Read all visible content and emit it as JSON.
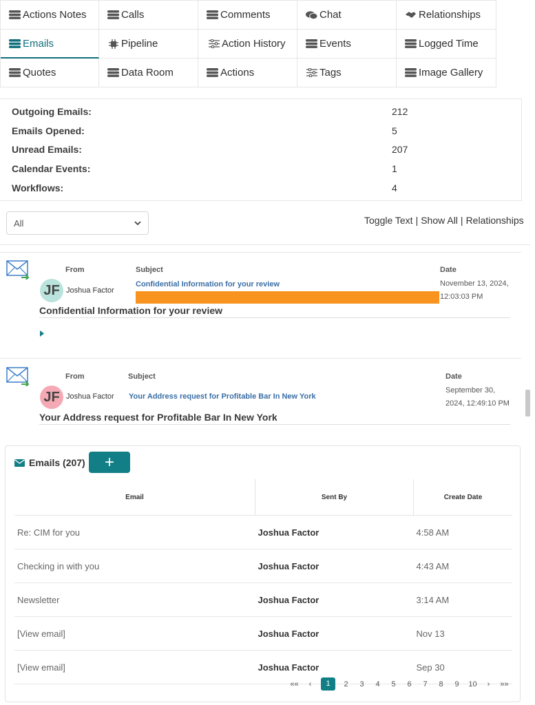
{
  "tabs": [
    {
      "label": "Actions Notes",
      "icon": "stack-icon"
    },
    {
      "label": "Calls",
      "icon": "stack-icon"
    },
    {
      "label": "Comments",
      "icon": "stack-icon"
    },
    {
      "label": "Chat",
      "icon": "chat-icon"
    },
    {
      "label": "Relationships",
      "icon": "handshake-icon"
    },
    {
      "label": "Emails",
      "icon": "stack-icon",
      "active": true
    },
    {
      "label": "Pipeline",
      "icon": "chip-icon"
    },
    {
      "label": "Action History",
      "icon": "sliders-icon"
    },
    {
      "label": "Events",
      "icon": "stack-icon"
    },
    {
      "label": "Logged Time",
      "icon": "stack-icon"
    },
    {
      "label": "Quotes",
      "icon": "stack-icon"
    },
    {
      "label": "Data Room",
      "icon": "stack-icon"
    },
    {
      "label": "Actions",
      "icon": "stack-icon"
    },
    {
      "label": "Tags",
      "icon": "sliders-icon"
    },
    {
      "label": "Image Gallery",
      "icon": "stack-icon"
    }
  ],
  "stats": [
    {
      "label": "Outgoing Emails:",
      "value": "212"
    },
    {
      "label": "Emails Opened:",
      "value": "5"
    },
    {
      "label": "Unread Emails:",
      "value": "207"
    },
    {
      "label": "Calendar Events:",
      "value": "1"
    },
    {
      "label": "Workflows:",
      "value": "4"
    }
  ],
  "filter": {
    "selected": "All"
  },
  "links": {
    "toggle_text": "Toggle Text",
    "show_all": "Show All",
    "relationships": "Relationships"
  },
  "entry_headers": {
    "from": "From",
    "subject": "Subject",
    "date": "Date"
  },
  "entries": [
    {
      "initials": "JF",
      "from": "Joshua Factor",
      "subject": "Confidential Information for your review",
      "date_line1": "November 13, 2024,",
      "date_line2": "12:03:03 PM",
      "title": "Confidential Information for your review",
      "avatar_color": "#b9e3dc"
    },
    {
      "initials": "JF",
      "from": "Joshua Factor",
      "subject": "Your Address request for Profitable Bar In New York",
      "date_line1": "September 30,",
      "date_line2": "2024, 12:49:10 PM",
      "title": "Your Address request for Profitable Bar In New York",
      "avatar_color": "#f5a9b4"
    }
  ],
  "highlight_color": "#f7931e",
  "accent_color": "#127f86",
  "panel": {
    "title": "Emails (207)",
    "add_label": "+",
    "columns": [
      "Email",
      "Sent By",
      "Create Date"
    ],
    "rows": [
      {
        "email": "Re: CIM for you",
        "sent_by": "Joshua Factor",
        "date": "4:58 AM"
      },
      {
        "email": "Checking in with you",
        "sent_by": "Joshua Factor",
        "date": "4:43 AM"
      },
      {
        "email": "Newsletter",
        "sent_by": "Joshua Factor",
        "date": "3:14 AM"
      },
      {
        "email": "[View email]",
        "sent_by": "Joshua Factor",
        "date": "Nov 13"
      },
      {
        "email": "[View email]",
        "sent_by": "Joshua Factor",
        "date": "Sep 30"
      }
    ],
    "pagination": {
      "first": "««",
      "prev": "‹",
      "pages": [
        "1",
        "2",
        "3",
        "4",
        "5",
        "6",
        "7",
        "8",
        "9",
        "10"
      ],
      "current": "1",
      "next": "›",
      "last": "»»"
    }
  }
}
